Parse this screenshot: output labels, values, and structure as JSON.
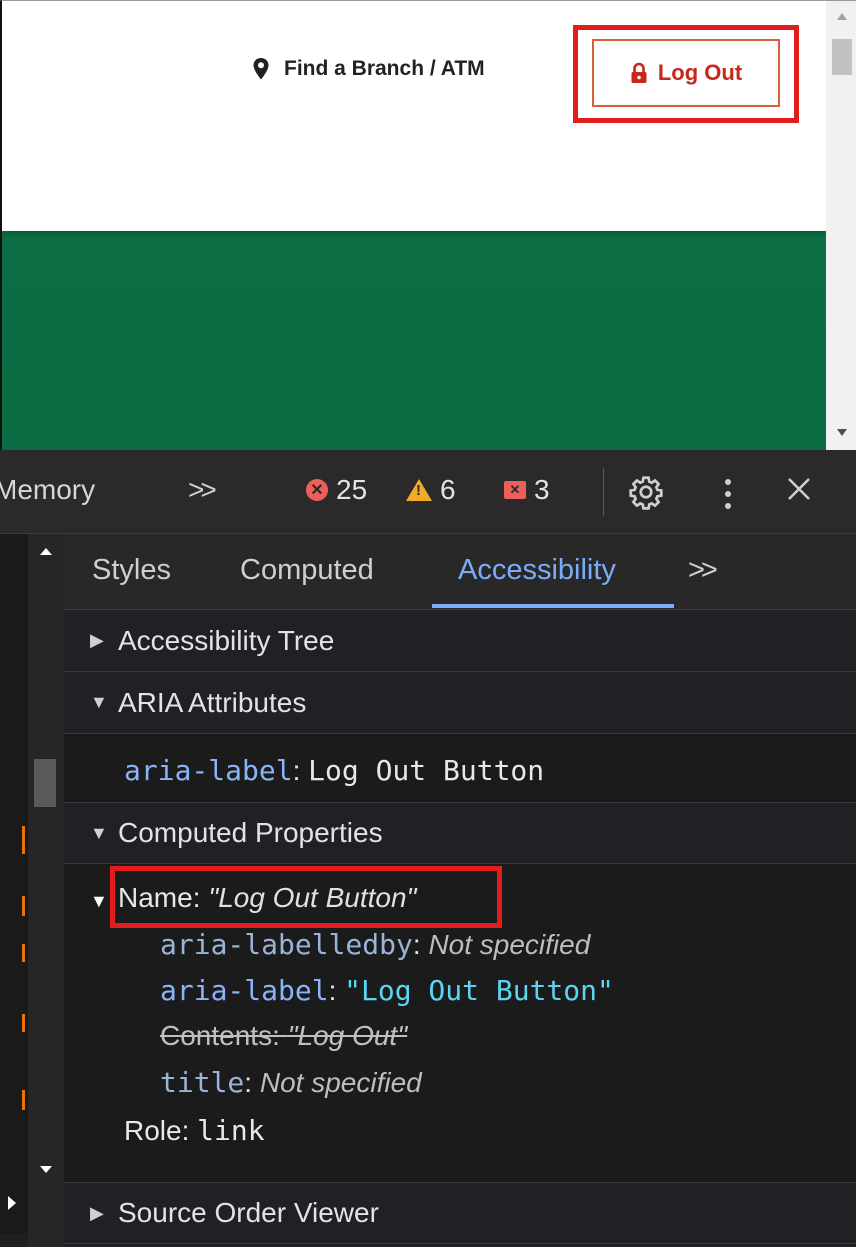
{
  "page": {
    "branch_link_label": "Find a Branch / ATM",
    "logout_label": "Log Out"
  },
  "devtools": {
    "toolbar": {
      "memory_tab": "Memory",
      "more_tabs": ">>",
      "error_count": "25",
      "warning_count": "6",
      "issue_count": "3"
    },
    "panel_tabs": {
      "styles": "Styles",
      "computed": "Computed",
      "accessibility": "Accessibility",
      "more": ">>"
    },
    "accessibility": {
      "tree_header": "Accessibility Tree",
      "aria_header": "ARIA Attributes",
      "aria_label_name": "aria-label",
      "aria_label_value": "Log Out Button",
      "computed_header": "Computed Properties",
      "name_label": "Name: ",
      "name_value": "\"Log Out Button\"",
      "labelledby_name": "aria-labelledby",
      "labelledby_value": "Not specified",
      "aria_label_value_quoted": "\"Log Out Button\"",
      "contents_text": "Contents: ",
      "contents_value": "\"Log Out\"",
      "title_name": "title",
      "title_value": "Not specified",
      "role_label": "Role: ",
      "role_value": "link",
      "source_order_header": "Source Order Viewer"
    }
  },
  "colors": {
    "banner_green": "#0b6b42",
    "logout_red": "#c8281c",
    "highlight_red": "#e11d1d",
    "accent_blue": "#7cacf8"
  }
}
